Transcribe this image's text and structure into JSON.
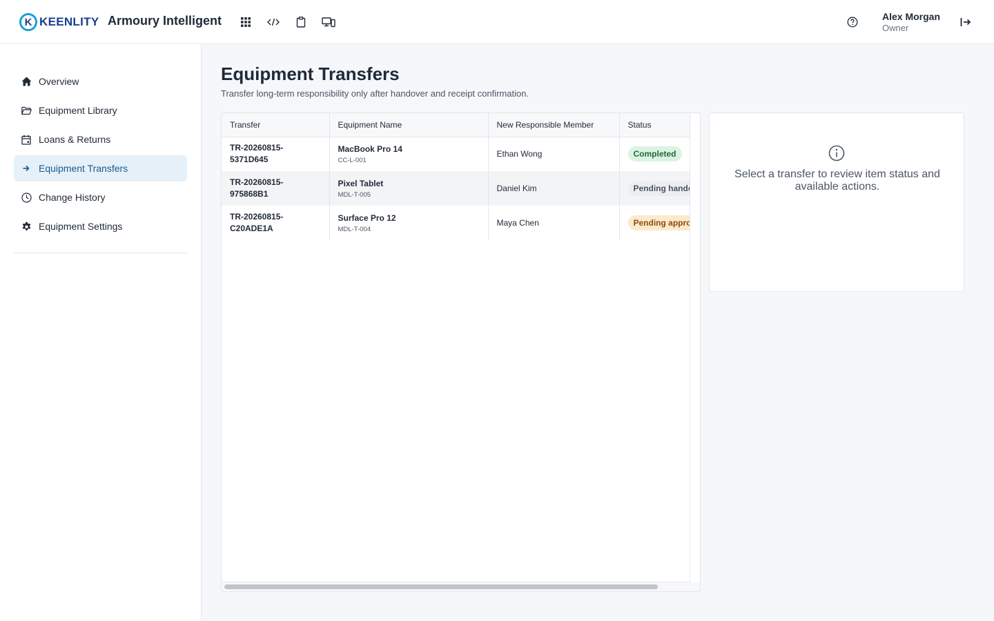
{
  "header": {
    "logo_text": "KEENLITY",
    "logo_mark": "K",
    "app_name": "Armoury Intelligent",
    "icons": [
      "apps-grid-icon",
      "code-icon",
      "clipboard-icon",
      "devices-icon",
      "help-icon",
      "logout-icon"
    ],
    "user": {
      "name": "Alex Morgan",
      "role": "Owner"
    }
  },
  "sidebar": {
    "items": [
      {
        "label": "Overview",
        "icon": "home-icon",
        "active": false
      },
      {
        "label": "Equipment Library",
        "icon": "folder-icon",
        "active": false
      },
      {
        "label": "Loans & Returns",
        "icon": "calendar-icon",
        "active": false
      },
      {
        "label": "Equipment Transfers",
        "icon": "arrow-right-icon",
        "active": true
      },
      {
        "label": "Change History",
        "icon": "clock-icon",
        "active": false
      },
      {
        "label": "Equipment Settings",
        "icon": "gear-icon",
        "active": false
      }
    ]
  },
  "main": {
    "title": "Equipment Transfers",
    "subtitle": "Transfer long-term responsibility only after handover and receipt confirmation.",
    "table": {
      "columns": [
        "Transfer",
        "Equipment Name",
        "New Responsible Member",
        "Status"
      ],
      "rows": [
        {
          "id_line1": "TR-20260815-",
          "id_line2": "5371D645",
          "equipment": "MacBook Pro 14",
          "code": "CC-L-001",
          "member": "Ethan Wong",
          "status": "Completed"
        },
        {
          "id_line1": "TR-20260815-",
          "id_line2": "975868B1",
          "equipment": "Pixel Tablet",
          "code": "MDL-T-005",
          "member": "Daniel Kim",
          "status": "Pending handover"
        },
        {
          "id_line1": "TR-20260815-",
          "id_line2": "C20ADE1A",
          "equipment": "Surface Pro 12",
          "code": "MDL-T-004",
          "member": "Maya Chen",
          "status": "Pending approval"
        }
      ]
    },
    "detail": {
      "icon": "info-icon",
      "message": "Select a transfer to review item status and available actions."
    }
  },
  "colors": {
    "accent": "#1a5a8c",
    "active_nav_bg": "#e6f0f8",
    "completed_bg": "#dcf3e3",
    "pending_handover_bg": "#eceef1",
    "pending_approval_bg": "#fde9cc"
  }
}
